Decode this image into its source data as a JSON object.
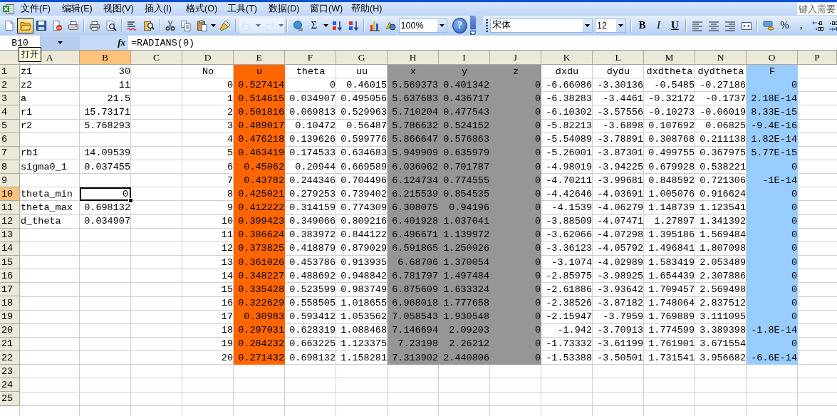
{
  "menu": [
    {
      "label": "文件(F)"
    },
    {
      "label": "编辑(E)"
    },
    {
      "label": "视图(V)"
    },
    {
      "label": "插入(I)"
    },
    {
      "label": "格式(O)"
    },
    {
      "label": "工具(T)"
    },
    {
      "label": "数据(D)"
    },
    {
      "label": "窗口(W)"
    },
    {
      "label": "帮助(H)"
    }
  ],
  "help_search": {
    "placeholder": "键入需要"
  },
  "standard_toolbar": [
    {
      "kind": "new-document",
      "hovered": false,
      "disabled": false
    },
    {
      "kind": "folder",
      "hovered": true,
      "disabled": false
    },
    {
      "kind": "floppy",
      "hovered": false,
      "disabled": false
    },
    {
      "kind": "permission",
      "hovered": false,
      "disabled": false
    },
    {
      "kind": "fax",
      "hovered": false,
      "disabled": false
    },
    {
      "kind": "separator"
    },
    {
      "kind": "printer",
      "hovered": false,
      "disabled": false
    },
    {
      "kind": "print-preview",
      "hovered": false,
      "disabled": false
    },
    {
      "kind": "separator"
    },
    {
      "kind": "spelling",
      "hovered": false,
      "disabled": false
    },
    {
      "kind": "research",
      "hovered": false,
      "disabled": false
    },
    {
      "kind": "separator"
    },
    {
      "kind": "scissors",
      "hovered": false,
      "disabled": false
    },
    {
      "kind": "copy",
      "hovered": false,
      "disabled": false
    },
    {
      "kind": "clipboard",
      "hovered": false,
      "disabled": false,
      "dropdown": true
    },
    {
      "kind": "brush",
      "hovered": false,
      "disabled": false
    },
    {
      "kind": "separator"
    },
    {
      "kind": "undo",
      "hovered": false,
      "disabled": true,
      "dropdown": true
    },
    {
      "kind": "redo",
      "hovered": false,
      "disabled": true,
      "dropdown": true
    },
    {
      "kind": "separator"
    },
    {
      "kind": "globe-link",
      "hovered": false,
      "disabled": false
    },
    {
      "kind": "autosum",
      "label": "Σ",
      "hovered": false,
      "disabled": false,
      "dropdown": true
    },
    {
      "kind": "sort-ascending",
      "hovered": false,
      "disabled": false
    },
    {
      "kind": "sort-descending",
      "hovered": false,
      "disabled": false
    },
    {
      "kind": "separator"
    },
    {
      "kind": "chart",
      "hovered": false,
      "disabled": false
    },
    {
      "kind": "drawing",
      "hovered": false,
      "disabled": false
    },
    {
      "kind": "zoom",
      "value": "100%"
    },
    {
      "kind": "help",
      "label": "?",
      "hovered": false,
      "disabled": false
    }
  ],
  "formatting_toolbar": [
    {
      "kind": "font",
      "value": "宋体"
    },
    {
      "kind": "size",
      "value": "12"
    },
    {
      "kind": "separator"
    },
    {
      "kind": "bold",
      "label": "B",
      "hovered": false,
      "disabled": false
    },
    {
      "kind": "italic",
      "label": "I",
      "hovered": false,
      "disabled": false
    },
    {
      "kind": "underline",
      "label": "U",
      "hovered": false,
      "disabled": false
    },
    {
      "kind": "separator"
    },
    {
      "kind": "align-left",
      "hovered": false,
      "disabled": false
    },
    {
      "kind": "align-center",
      "hovered": false,
      "disabled": false
    },
    {
      "kind": "align-right",
      "hovered": false,
      "disabled": false
    },
    {
      "kind": "merge-center",
      "hovered": false,
      "disabled": false
    },
    {
      "kind": "separator"
    },
    {
      "kind": "currency",
      "hovered": false,
      "disabled": false
    },
    {
      "kind": "percent",
      "label": "%",
      "hovered": false,
      "disabled": false
    },
    {
      "kind": "comma",
      "label": ",",
      "hovered": false,
      "disabled": false
    },
    {
      "kind": "increase-decimal",
      "hovered": false,
      "disabled": false
    },
    {
      "kind": "decrease-decimal",
      "hovered": false,
      "disabled": false
    }
  ],
  "formula_bar": {
    "name_box": "B10",
    "function_label": "fx",
    "formula": "=RADIANS(0)"
  },
  "tooltip": "打开",
  "columns": [
    {
      "label": "A",
      "selected": false
    },
    {
      "label": "B",
      "selected": true
    },
    {
      "label": "C",
      "selected": false
    },
    {
      "label": "D",
      "selected": false
    },
    {
      "label": "E",
      "selected": false,
      "color": "#ff6600"
    },
    {
      "label": "F",
      "selected": false
    },
    {
      "label": "G",
      "selected": false
    },
    {
      "label": "H",
      "selected": false,
      "color": "#969696"
    },
    {
      "label": "I",
      "selected": false,
      "color": "#969696"
    },
    {
      "label": "J",
      "selected": false,
      "color": "#969696"
    },
    {
      "label": "K",
      "selected": false
    },
    {
      "label": "L",
      "selected": false
    },
    {
      "label": "M",
      "selected": false
    },
    {
      "label": "N",
      "selected": false
    },
    {
      "label": "O",
      "selected": false,
      "color": "#99ccff"
    },
    {
      "label": "P",
      "selected": false
    }
  ],
  "rows": [
    {
      "header": "1",
      "selected": false,
      "cells": [
        "z1",
        "30",
        null,
        "No",
        "u",
        "theta",
        "uu",
        "x",
        "y",
        "z",
        "dxdu",
        "dydu",
        "dxdtheta",
        "dydtheta",
        "F"
      ]
    },
    {
      "header": "2",
      "selected": false,
      "cells": [
        "z2",
        "11",
        null,
        "0",
        "0.527414",
        "0",
        "0.46015",
        "5.569373",
        "0.401342",
        "0",
        "-6.66086",
        "-3.30136",
        "-0.5485",
        "-0.27186",
        "0"
      ]
    },
    {
      "header": "3",
      "selected": false,
      "cells": [
        "a",
        "21.5",
        null,
        "1",
        "0.514615",
        "0.034907",
        "0.495056",
        "5.637683",
        "0.436717",
        "0",
        "-6.38283",
        "-3.4461",
        "-0.32172",
        "-0.1737",
        "2.18E-14"
      ]
    },
    {
      "header": "4",
      "selected": false,
      "cells": [
        "r1",
        "15.73171",
        null,
        "2",
        "0.501816",
        "0.069813",
        "0.529963",
        "5.710204",
        "0.477543",
        "0",
        "-6.10302",
        "-3.57556",
        "-0.10273",
        "-0.06019",
        "8.33E-15"
      ]
    },
    {
      "header": "5",
      "selected": false,
      "cells": [
        "r2",
        "5.768293",
        null,
        "3",
        "0.489017",
        "0.10472",
        "0.56487",
        "5.786632",
        "0.524152",
        "0",
        "-5.82213",
        "-3.6898",
        "0.107692",
        "0.06825",
        "-9.4E-16"
      ]
    },
    {
      "header": "6",
      "selected": false,
      "cells": [
        null,
        null,
        null,
        "4",
        "0.476218",
        "0.139626",
        "0.599776",
        "5.866647",
        "0.576863",
        "0",
        "-5.54089",
        "-3.78891",
        "0.308768",
        "0.211138",
        "1.82E-14"
      ]
    },
    {
      "header": "7",
      "selected": false,
      "cells": [
        "rb1",
        "14.09539",
        null,
        "5",
        "0.463419",
        "0.174533",
        "0.634683",
        "5.949909",
        "0.635979",
        "0",
        "-5.26001",
        "-3.87301",
        "0.499755",
        "0.367975",
        "5.77E-15"
      ]
    },
    {
      "header": "8",
      "selected": false,
      "cells": [
        "sigma0_1",
        "0.037455",
        null,
        "6",
        "0.45062",
        "0.20944",
        "0.669589",
        "6.036062",
        "0.701787",
        "0",
        "-4.98019",
        "-3.94225",
        "0.679928",
        "0.538221",
        "0"
      ]
    },
    {
      "header": "9",
      "selected": false,
      "cells": [
        null,
        null,
        null,
        "7",
        "0.43782",
        "0.244346",
        "0.704496",
        "6.124734",
        "0.774555",
        "0",
        "-4.70211",
        "-3.99681",
        "0.848592",
        "0.721306",
        "-1E-14"
      ]
    },
    {
      "header": "10",
      "selected": true,
      "cells": [
        "theta_min",
        "0",
        null,
        "8",
        "0.425021",
        "0.279253",
        "0.739402",
        "6.215539",
        "0.854535",
        "0",
        "-4.42646",
        "-4.03691",
        "1.005076",
        "0.916624",
        "0"
      ]
    },
    {
      "header": "11",
      "selected": false,
      "cells": [
        "theta_max",
        "0.698132",
        null,
        "9",
        "0.412222",
        "0.314159",
        "0.774309",
        "6.308075",
        "0.94196",
        "0",
        "-4.1539",
        "-4.06279",
        "1.148739",
        "1.123541",
        "0"
      ]
    },
    {
      "header": "12",
      "selected": false,
      "cells": [
        "d_theta",
        "0.034907",
        null,
        "10",
        "0.399423",
        "0.349066",
        "0.809216",
        "6.401928",
        "1.037041",
        "0",
        "-3.88509",
        "-4.07471",
        "1.27897",
        "1.341392",
        "0"
      ]
    },
    {
      "header": "13",
      "selected": false,
      "cells": [
        null,
        null,
        null,
        "11",
        "0.386624",
        "0.383972",
        "0.844122",
        "6.496671",
        "1.139972",
        "0",
        "-3.62066",
        "-4.07298",
        "1.395186",
        "1.569484",
        "0"
      ]
    },
    {
      "header": "14",
      "selected": false,
      "cells": [
        null,
        null,
        null,
        "12",
        "0.373825",
        "0.418879",
        "0.879029",
        "6.591865",
        "1.250926",
        "0",
        "-3.36123",
        "-4.05792",
        "1.496841",
        "1.807098",
        "0"
      ]
    },
    {
      "header": "15",
      "selected": false,
      "cells": [
        null,
        null,
        null,
        "13",
        "0.361026",
        "0.453786",
        "0.913935",
        "6.68706",
        "1.370054",
        "0",
        "-3.1074",
        "-4.02989",
        "1.583419",
        "2.053489",
        "0"
      ]
    },
    {
      "header": "16",
      "selected": false,
      "cells": [
        null,
        null,
        null,
        "14",
        "0.348227",
        "0.488692",
        "0.948842",
        "6.781797",
        "1.497484",
        "0",
        "-2.85975",
        "-3.98925",
        "1.654439",
        "2.307886",
        "0"
      ]
    },
    {
      "header": "17",
      "selected": false,
      "cells": [
        null,
        null,
        null,
        "15",
        "0.335428",
        "0.523599",
        "0.983749",
        "6.875609",
        "1.633324",
        "0",
        "-2.61886",
        "-3.93642",
        "1.709457",
        "2.569498",
        "0"
      ]
    },
    {
      "header": "18",
      "selected": false,
      "cells": [
        null,
        null,
        null,
        "16",
        "0.322629",
        "0.558505",
        "1.018655",
        "6.968018",
        "1.777658",
        "0",
        "-2.38526",
        "-3.87182",
        "1.748064",
        "2.837512",
        "0"
      ]
    },
    {
      "header": "19",
      "selected": false,
      "cells": [
        null,
        null,
        null,
        "17",
        "0.30983",
        "0.593412",
        "1.053562",
        "7.058543",
        "1.930548",
        "0",
        "-2.15947",
        "-3.7959",
        "1.769889",
        "3.111095",
        "0"
      ]
    },
    {
      "header": "20",
      "selected": false,
      "cells": [
        null,
        null,
        null,
        "18",
        "0.297031",
        "0.628319",
        "1.088468",
        "7.146694",
        "2.09203",
        "0",
        "-1.942",
        "-3.70913",
        "1.774599",
        "3.389398",
        "-1.8E-14"
      ]
    },
    {
      "header": "21",
      "selected": false,
      "cells": [
        null,
        null,
        null,
        "19",
        "0.284232",
        "0.663225",
        "1.123375",
        "7.23198",
        "2.26212",
        "0",
        "-1.73332",
        "-3.61199",
        "1.761901",
        "3.671554",
        "0"
      ]
    },
    {
      "header": "22",
      "selected": false,
      "cells": [
        null,
        null,
        null,
        "20",
        "0.271432",
        "0.698132",
        "1.158281",
        "7.313902",
        "2.440806",
        "0",
        "-1.53388",
        "-3.50501",
        "1.731541",
        "3.956682",
        "-6.6E-14"
      ]
    },
    {
      "header": "23",
      "selected": false
    },
    {
      "header": "24",
      "selected": false
    },
    {
      "header": "25",
      "selected": false
    }
  ]
}
